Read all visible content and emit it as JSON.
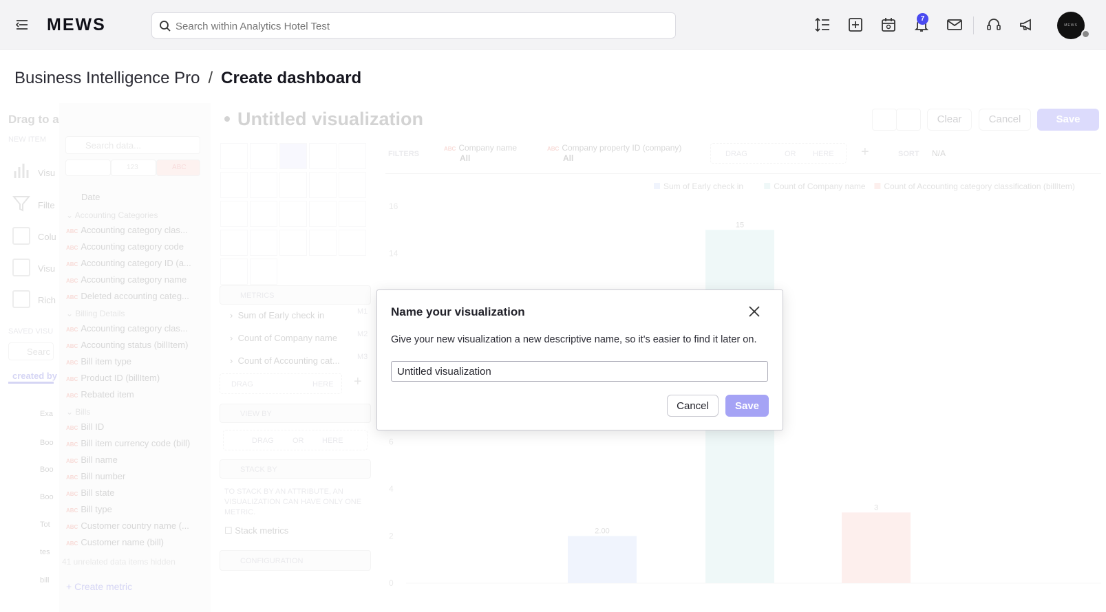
{
  "topbar": {
    "logo": "MEWS",
    "search_placeholder": "Search within Analytics Hotel Test",
    "notification_count": "7",
    "avatar_text": "MEWS"
  },
  "breadcrumb": {
    "parent": "Business Intelligence Pro",
    "separator": "/",
    "current": "Create dashboard"
  },
  "background": {
    "left_panel": {
      "title": "Drag to a",
      "new_item_label": "NEW ITEM",
      "items": [
        "Visu",
        "Filte",
        "Colu",
        "Visu",
        "Rich"
      ],
      "saved_label": "SAVED VISU",
      "saved_search": "Searc",
      "created_by": "created by",
      "saved_items": [
        "Exa",
        "Boo",
        "Boo",
        "Boo",
        "Tot",
        "tes",
        "bill"
      ]
    },
    "data_panel": {
      "search_placeholder": "Search data...",
      "tab_number": "123",
      "tab_text": "ABC",
      "date": "Date",
      "groups": [
        {
          "name": "Accounting Categories",
          "items": [
            "Accounting category clas...",
            "Accounting category code",
            "Accounting category ID (a...",
            "Accounting category name",
            "Deleted accounting categ..."
          ]
        },
        {
          "name": "Billing Details",
          "items": [
            "Accounting category clas...",
            "Accounting status (billItem)",
            "Bill item type",
            "Product ID (billItem)",
            "Rebated item"
          ]
        },
        {
          "name": "Bills",
          "items": [
            "Bill ID",
            "Bill item currency code (bill)",
            "Bill name",
            "Bill number",
            "Bill state",
            "Bill type",
            "Customer country name (...",
            "Customer name (bill)"
          ]
        }
      ],
      "hidden_note": "41 unrelated data items hidden",
      "create_metric": "Create metric"
    },
    "viz_title": "Untitled visualization",
    "toolbar": {
      "clear": "Clear",
      "cancel": "Cancel",
      "save": "Save"
    },
    "filters_label": "FILTERS",
    "filters": [
      {
        "name": "Company name",
        "value": "All"
      },
      {
        "name": "Company property ID (company)",
        "value": "All"
      }
    ],
    "drag_label": "DRAG",
    "or_label": "OR",
    "here_label": "HERE",
    "sort_label": "SORT",
    "sort_value": "N/A",
    "metrics_label": "METRICS",
    "metrics": [
      {
        "name": "Sum of Early check in",
        "id": "M1"
      },
      {
        "name": "Count of Company name",
        "id": "M2"
      },
      {
        "name": "Count of Accounting cat...",
        "id": "M3"
      }
    ],
    "view_by_label": "VIEW BY",
    "stack_by_label": "STACK BY",
    "stack_note": "TO STACK BY AN ATTRIBUTE, AN VISUALIZATION CAN HAVE ONLY ONE METRIC.",
    "stack_metrics": "Stack metrics",
    "configuration": "CONFIGURATION"
  },
  "chart_data": {
    "type": "bar",
    "categories": [
      "Sum of Early check in",
      "Count of Company name",
      "Count of Accounting category classification (billItem)"
    ],
    "values": [
      2,
      15,
      3
    ],
    "data_labels": [
      "2.00",
      "15",
      "3"
    ],
    "colors": [
      "#b9cdf7",
      "#b3e2de",
      "#f8b8ab"
    ],
    "ylim": [
      0,
      16
    ],
    "yticks": [
      "0",
      "2",
      "4",
      "6",
      "14",
      "16"
    ],
    "legend": [
      "Sum of Early check in",
      "Count of Company name",
      "Count of Accounting category classification (billItem)"
    ]
  },
  "modal": {
    "title": "Name your visualization",
    "description": "Give your new visualization a new descriptive name, so it's easier to find it later on.",
    "input_value": "Untitled visualization",
    "cancel_label": "Cancel",
    "save_label": "Save"
  }
}
